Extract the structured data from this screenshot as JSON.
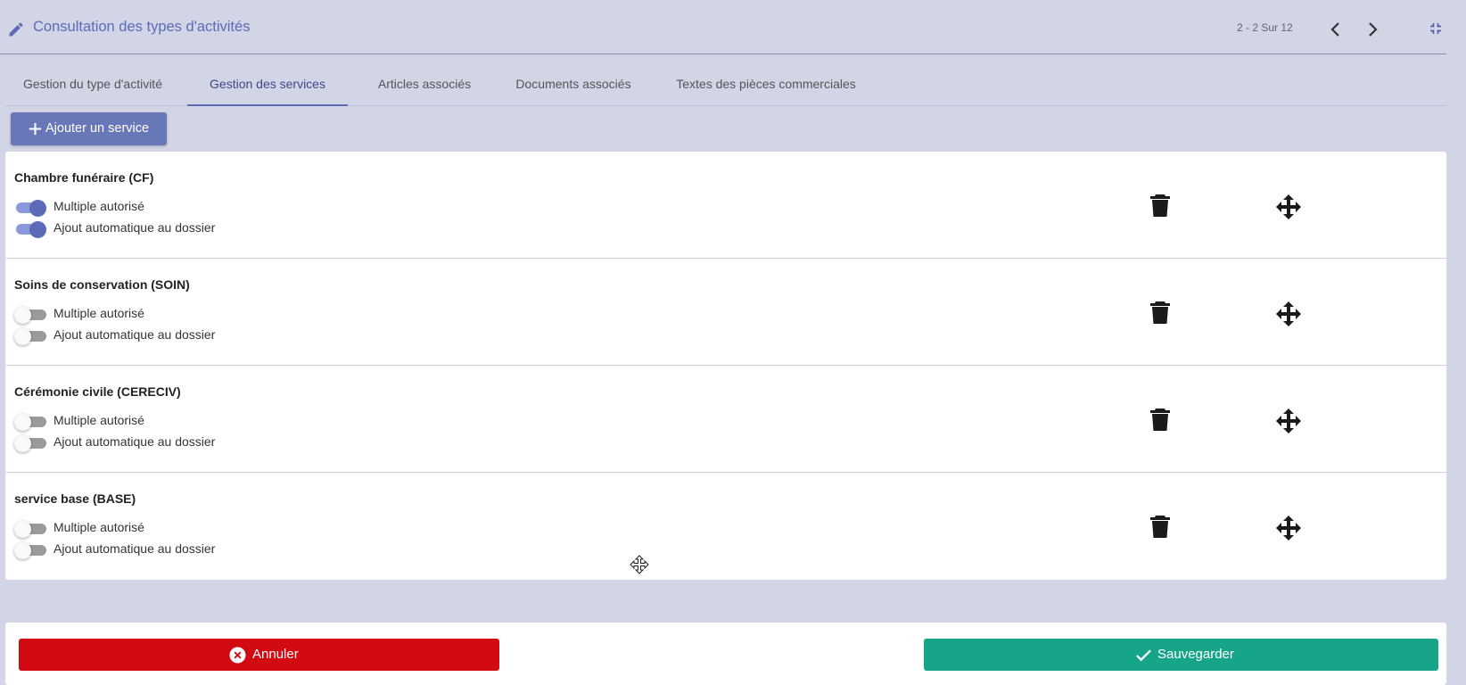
{
  "header": {
    "title": "Consultation des types d'activités",
    "paging": "2 - 2 Sur 12"
  },
  "tabs": [
    {
      "label": "Gestion du type d'activité",
      "active": false
    },
    {
      "label": "Gestion des services",
      "active": true
    },
    {
      "label": "Articles associés",
      "active": false
    },
    {
      "label": "Documents associés",
      "active": false
    },
    {
      "label": "Textes des pièces commerciales",
      "active": false
    }
  ],
  "add_button_label": "Ajouter un service",
  "services": [
    {
      "name": "Chambre funéraire (CF)",
      "multiple_label": "Multiple autorisé",
      "multiple_on": true,
      "auto_label": "Ajout automatique au dossier",
      "auto_on": true
    },
    {
      "name": "Soins de conservation (SOIN)",
      "multiple_label": "Multiple autorisé",
      "multiple_on": false,
      "auto_label": "Ajout automatique au dossier",
      "auto_on": false
    },
    {
      "name": "Cérémonie civile (CERECIV)",
      "multiple_label": "Multiple autorisé",
      "multiple_on": false,
      "auto_label": "Ajout automatique au dossier",
      "auto_on": false
    },
    {
      "name": "service base (BASE)",
      "multiple_label": "Multiple autorisé",
      "multiple_on": false,
      "auto_label": "Ajout automatique au dossier",
      "auto_on": false
    }
  ],
  "footer": {
    "cancel_label": "Annuler",
    "save_label": "Sauvegarder"
  },
  "colors": {
    "accent": "#5c6bb8",
    "background": "#d1d5e6",
    "cancel": "#d20a12",
    "save": "#17a589",
    "toggle_on_track": "#8b98dd"
  }
}
